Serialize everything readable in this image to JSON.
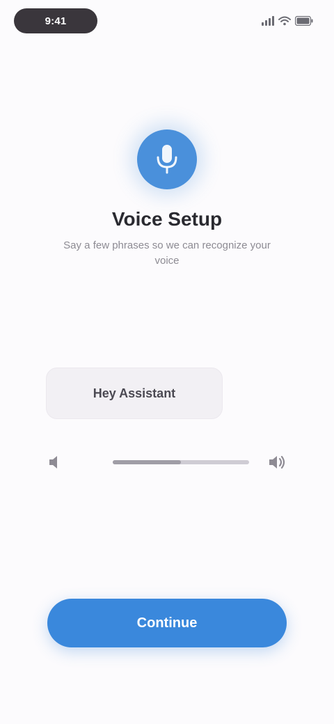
{
  "status_bar": {
    "time": "9:41",
    "icons": [
      "signal-icon",
      "wifi-icon",
      "battery-icon"
    ]
  },
  "hero": {
    "icon": "microphone-icon",
    "title": "Voice Setup",
    "subtitle": "Say a few phrases so we can recognize your voice"
  },
  "card": {
    "label": "Hey Assistant"
  },
  "slider": {
    "left_icon": "volume-low-icon",
    "right_icon": "volume-high-icon",
    "value": 0.5
  },
  "primary_action": {
    "label": "Continue"
  },
  "colors": {
    "accent": "#3a88dc",
    "hero": "#4a90db",
    "background": "#fcfbfd"
  }
}
